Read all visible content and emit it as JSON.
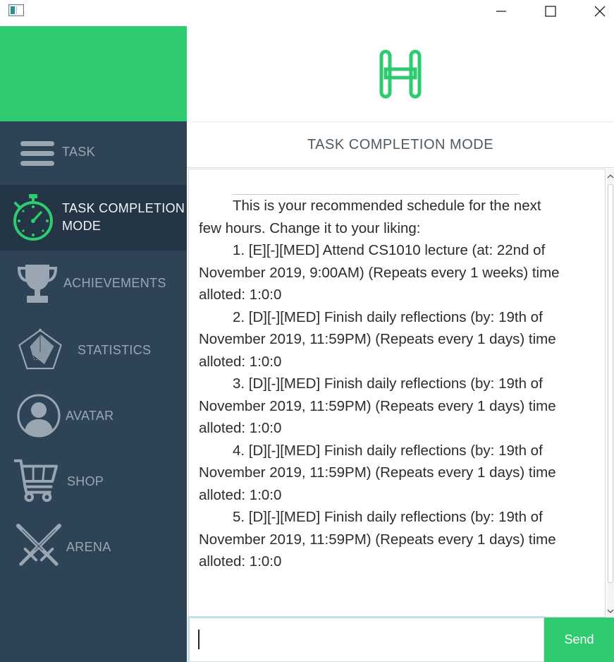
{
  "window": {
    "minimize_icon": "minimize-icon",
    "maximize_icon": "maximize-icon",
    "close_icon": "close-icon"
  },
  "colors": {
    "accent": "#2ecb71",
    "sidebar": "#2f4356",
    "sidebar_active": "#243646"
  },
  "sidebar": {
    "items": [
      {
        "label": "TASK",
        "icon": "menu-icon"
      },
      {
        "label": "TASK COMPLETION",
        "label2": "MODE",
        "icon": "stopwatch-icon",
        "active": true
      },
      {
        "label": "ACHIEVEMENTS",
        "icon": "trophy-icon"
      },
      {
        "label": "STATISTICS",
        "icon": "radar-chart-icon"
      },
      {
        "label": "AVATAR",
        "icon": "user-avatar-icon"
      },
      {
        "label": "SHOP",
        "icon": "shopping-cart-icon"
      },
      {
        "label": "ARENA",
        "icon": "crossed-swords-icon"
      }
    ]
  },
  "main": {
    "logo_icon": "h-logo-icon",
    "title": "TASK COMPLETION MODE",
    "chat": {
      "rule": "_______________________________________",
      "lines": [
        "This is your recommended schedule for the next",
        "few hours. Change it to your liking:",
        "1. [E][-][MED] Attend CS1010 lecture (at: 22nd of",
        "November 2019, 9:00AM) (Repeats every 1 weeks) time",
        "alloted: 1:0:0",
        "2. [D][-][MED] Finish daily reflections (by: 19th of",
        "November 2019, 11:59PM) (Repeats every 1 days) time",
        "alloted: 1:0:0",
        "3. [D][-][MED] Finish daily reflections (by: 19th of",
        "November 2019, 11:59PM) (Repeats every 1 days) time",
        "alloted: 1:0:0",
        "4. [D][-][MED] Finish daily reflections (by: 19th of",
        "November 2019, 11:59PM) (Repeats every 1 days) time",
        "alloted: 1:0:0",
        "5. [D][-][MED] Finish daily reflections (by: 19th of",
        "November 2019, 11:59PM) (Repeats every 1 days) time",
        "alloted: 1:0:0"
      ]
    },
    "input": {
      "value": "",
      "send_label": "Send"
    }
  }
}
